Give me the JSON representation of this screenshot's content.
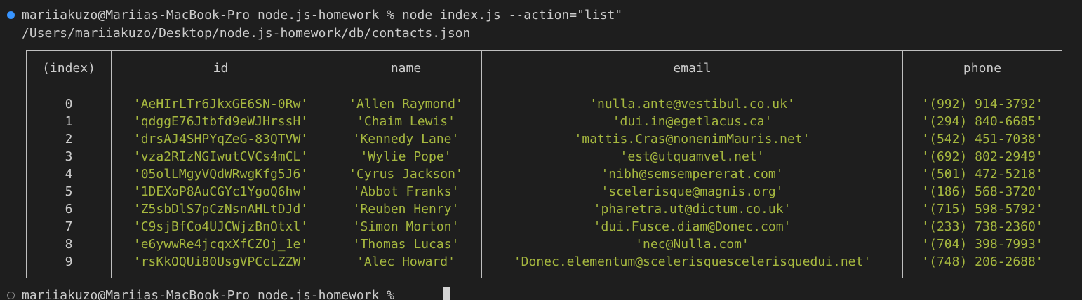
{
  "terminal": {
    "command_prompt": "mariiakuzo@Mariias-MacBook-Pro node.js-homework % node index.js --action=\"list\"",
    "output_path": "/Users/mariiakuzo/Desktop/node.js-homework/db/contacts.json",
    "next_prompt": "mariiakuzo@Mariias-MacBook-Pro node.js-homework % "
  },
  "table": {
    "headers": [
      "(index)",
      "id",
      "name",
      "email",
      "phone"
    ],
    "rows": [
      {
        "index": "0",
        "id": "'AeHIrLTr6JkxGE6SN-0Rw'",
        "name": "'Allen Raymond'",
        "email": "'nulla.ante@vestibul.co.uk'",
        "phone": "'(992) 914-3792'"
      },
      {
        "index": "1",
        "id": "'qdggE76Jtbfd9eWJHrssH'",
        "name": "'Chaim Lewis'",
        "email": "'dui.in@egetlacus.ca'",
        "phone": "'(294) 840-6685'"
      },
      {
        "index": "2",
        "id": "'drsAJ4SHPYqZeG-83QTVW'",
        "name": "'Kennedy Lane'",
        "email": "'mattis.Cras@nonenimMauris.net'",
        "phone": "'(542) 451-7038'"
      },
      {
        "index": "3",
        "id": "'vza2RIzNGIwutCVCs4mCL'",
        "name": "'Wylie Pope'",
        "email": "'est@utquamvel.net'",
        "phone": "'(692) 802-2949'"
      },
      {
        "index": "4",
        "id": "'05olLMgyVQdWRwgKfg5J6'",
        "name": "'Cyrus Jackson'",
        "email": "'nibh@semsempererat.com'",
        "phone": "'(501) 472-5218'"
      },
      {
        "index": "5",
        "id": "'1DEXoP8AuCGYc1YgoQ6hw'",
        "name": "'Abbot Franks'",
        "email": "'scelerisque@magnis.org'",
        "phone": "'(186) 568-3720'"
      },
      {
        "index": "6",
        "id": "'Z5sbDlS7pCzNsnAHLtDJd'",
        "name": "'Reuben Henry'",
        "email": "'pharetra.ut@dictum.co.uk'",
        "phone": "'(715) 598-5792'"
      },
      {
        "index": "7",
        "id": "'C9sjBfCo4UJCWjzBnOtxl'",
        "name": "'Simon Morton'",
        "email": "'dui.Fusce.diam@Donec.com'",
        "phone": "'(233) 738-2360'"
      },
      {
        "index": "8",
        "id": "'e6ywwRe4jcqxXfCZOj_1e'",
        "name": "'Thomas Lucas'",
        "email": "'nec@Nulla.com'",
        "phone": "'(704) 398-7993'"
      },
      {
        "index": "9",
        "id": "'rsKkOQUi80UsgVPCcLZZW'",
        "name": "'Alec Howard'",
        "email": "'Donec.elementum@scelerisquescelerisquedui.net'",
        "phone": "'(748) 206-2688'"
      }
    ]
  },
  "colors": {
    "background": "#1e1e1e",
    "text": "#cccccc",
    "string_value": "#a6b83f",
    "border": "#bfbfbf",
    "prompt_dot_active": "#3794ff"
  }
}
